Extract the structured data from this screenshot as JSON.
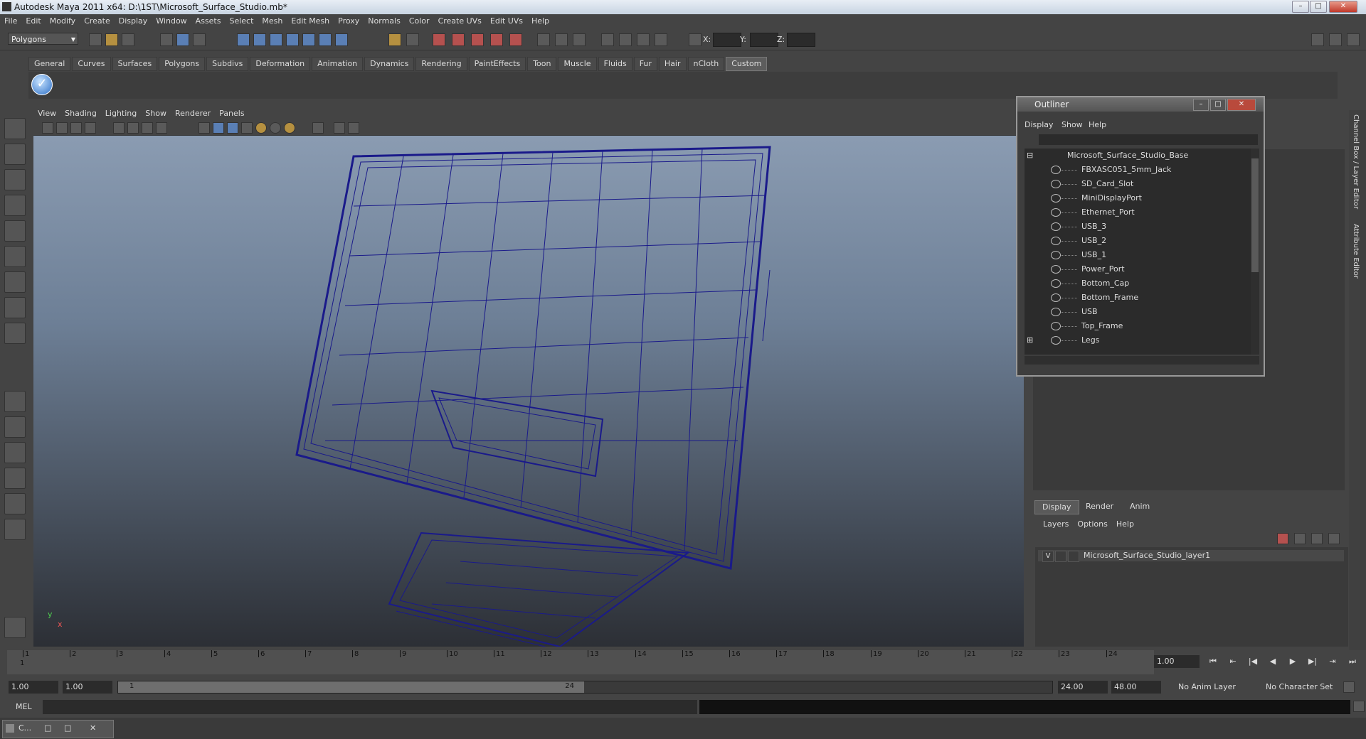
{
  "window": {
    "title": "Autodesk Maya 2011 x64: D:\\1ST\\Microsoft_Surface_Studio.mb*",
    "min": "–",
    "max": "□",
    "close": "✕"
  },
  "menubar": [
    "File",
    "Edit",
    "Modify",
    "Create",
    "Display",
    "Window",
    "Assets",
    "Select",
    "Mesh",
    "Edit Mesh",
    "Proxy",
    "Normals",
    "Color",
    "Create UVs",
    "Edit UVs",
    "Help"
  ],
  "toolbar": {
    "mode": "Polygons",
    "x_label": "X:",
    "y_label": "Y:",
    "z_label": "Z:"
  },
  "shelf_tabs": [
    "General",
    "Curves",
    "Surfaces",
    "Polygons",
    "Subdivs",
    "Deformation",
    "Animation",
    "Dynamics",
    "Rendering",
    "PaintEffects",
    "Toon",
    "Muscle",
    "Fluids",
    "Fur",
    "Hair",
    "nCloth",
    "Custom"
  ],
  "shelf_active": "Custom",
  "viewport": {
    "menu": [
      "View",
      "Shading",
      "Lighting",
      "Show",
      "Renderer",
      "Panels"
    ],
    "camera": "persp",
    "axis_x": "x",
    "axis_y": "y"
  },
  "outliner": {
    "title": "Outliner",
    "menu": [
      "Display",
      "Show",
      "Help"
    ],
    "items": [
      "Microsoft_Surface_Studio_Base",
      "FBXASC051_5mm_Jack",
      "SD_Card_Slot",
      "MiniDisplayPort",
      "Ethernet_Port",
      "USB_3",
      "USB_2",
      "USB_1",
      "Power_Port",
      "Bottom_Cap",
      "Bottom_Frame",
      "USB",
      "Top_Frame",
      "Legs"
    ]
  },
  "side_tabs": {
    "channel": "Channel Box / Layer Editor",
    "attribute": "Attribute Editor"
  },
  "layer_editor": {
    "tabs": [
      "Display",
      "Render",
      "Anim"
    ],
    "menu": [
      "Layers",
      "Options",
      "Help"
    ],
    "layer_visible": "V",
    "layer_name": "Microsoft_Surface_Studio_layer1"
  },
  "timeline": {
    "ticks": [
      "1",
      "2",
      "3",
      "4",
      "5",
      "6",
      "7",
      "8",
      "9",
      "10",
      "11",
      "12",
      "13",
      "14",
      "15",
      "16",
      "17",
      "18",
      "19",
      "20",
      "21",
      "22",
      "23",
      "24"
    ],
    "current_frame": "1",
    "time_value": "1.00"
  },
  "range": {
    "start": "1.00",
    "start2": "1.00",
    "slider_start": "1",
    "slider_end": "24",
    "end": "24.00",
    "end2": "48.00",
    "anim_layer": "No Anim Layer",
    "char_set": "No Character Set"
  },
  "mel": {
    "label": "MEL"
  },
  "taskbar": {
    "item": "C..."
  }
}
